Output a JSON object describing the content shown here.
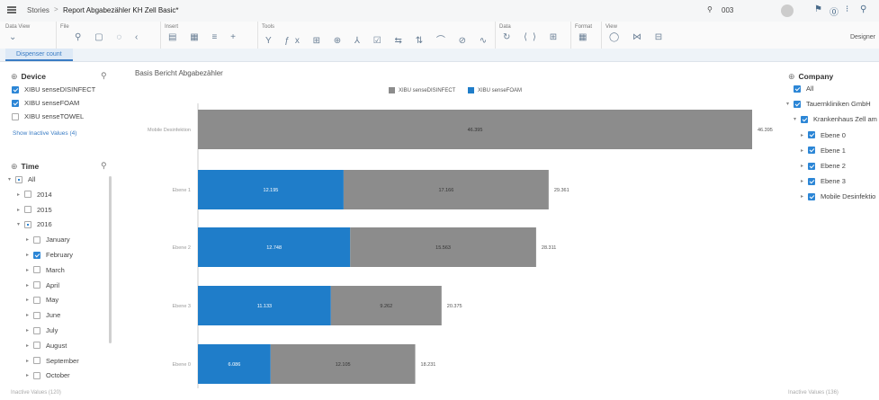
{
  "header": {
    "breadcrumb_root": "Stories",
    "separator": ">",
    "story_title": "Report Abgabezähler KH Zell Basic*",
    "search_value": "003"
  },
  "toolbar": {
    "groups": [
      {
        "label": "Data View",
        "icons": "⌄"
      },
      {
        "label": "File",
        "icons": "⚲ ▢ ◌ ‹"
      },
      {
        "label": "Insert",
        "icons": "▤ ▦ ≡ +"
      },
      {
        "label": "Tools",
        "icons": "Y ƒx ⊞ ⊕ ⅄ ☑ ⇆ ⇅ ⌒ ⊘ ∿"
      },
      {
        "label": "Data",
        "icons": "↻ ⟨⟩ ⊞"
      },
      {
        "label": "Format",
        "icons": "▦"
      },
      {
        "label": "View",
        "icons": "◯ ⋈ ⊟"
      }
    ],
    "designer_label": "Designer"
  },
  "tabs": [
    "Dispenser count"
  ],
  "device_filter": {
    "title": "Device",
    "items": [
      {
        "label": "XIBU senseDISINFECT",
        "checked": true
      },
      {
        "label": "XIBU senseFOAM",
        "checked": true
      },
      {
        "label": "XIBU senseTOWEL",
        "checked": false
      }
    ],
    "show_inactive": "Show Inactive Values (4)"
  },
  "time_filter": {
    "title": "Time",
    "items": [
      {
        "label": "All",
        "state": "partial",
        "caret": "▾",
        "indent": 0
      },
      {
        "label": "2014",
        "state": "off",
        "caret": "▸",
        "indent": 1
      },
      {
        "label": "2015",
        "state": "off",
        "caret": "▸",
        "indent": 1
      },
      {
        "label": "2016",
        "state": "partial",
        "caret": "▾",
        "indent": 1
      },
      {
        "label": "January",
        "state": "off",
        "caret": "▸",
        "indent": 2
      },
      {
        "label": "February",
        "state": "on",
        "caret": "▸",
        "indent": 2
      },
      {
        "label": "March",
        "state": "off",
        "caret": "▸",
        "indent": 2
      },
      {
        "label": "April",
        "state": "off",
        "caret": "▸",
        "indent": 2
      },
      {
        "label": "May",
        "state": "off",
        "caret": "▸",
        "indent": 2
      },
      {
        "label": "June",
        "state": "off",
        "caret": "▸",
        "indent": 2
      },
      {
        "label": "July",
        "state": "off",
        "caret": "▸",
        "indent": 2
      },
      {
        "label": "August",
        "state": "off",
        "caret": "▸",
        "indent": 2
      },
      {
        "label": "September",
        "state": "off",
        "caret": "▸",
        "indent": 2
      },
      {
        "label": "October",
        "state": "off",
        "caret": "▸",
        "indent": 2
      }
    ],
    "inactive": "Inactive Values (120)"
  },
  "company_filter": {
    "title": "Company",
    "items": [
      {
        "label": "All",
        "caret": "",
        "indent": 0
      },
      {
        "label": "Tauernkliniken GmbH",
        "caret": "▾",
        "indent": 0
      },
      {
        "label": "Krankenhaus Zell am",
        "caret": "▾",
        "indent": 1
      },
      {
        "label": "Ebene 0",
        "caret": "▸",
        "indent": 2
      },
      {
        "label": "Ebene 1",
        "caret": "▸",
        "indent": 2
      },
      {
        "label": "Ebene 2",
        "caret": "▸",
        "indent": 2
      },
      {
        "label": "Ebene 3",
        "caret": "▸",
        "indent": 2
      },
      {
        "label": "Mobile Desinfektio",
        "caret": "▸",
        "indent": 2
      }
    ],
    "inactive": "Inactive Values (136)"
  },
  "colors": {
    "disinfect": "#8c8c8c",
    "foam": "#1f7dc9",
    "accent": "#2c86d6"
  },
  "chart_data": {
    "type": "bar",
    "orientation": "horizontal",
    "stacked": true,
    "title": "Basis Bericht Abgabezähler",
    "categories": [
      "Mobile Desinfektion",
      "Ebene 1",
      "Ebene 2",
      "Ebene 3",
      "Ebene 0"
    ],
    "series": [
      {
        "name": "XIBU senseFOAM",
        "values": [
          0,
          12195,
          12748,
          11133,
          6086
        ]
      },
      {
        "name": "XIBU senseDISINFECT",
        "values": [
          46395,
          17166,
          15563,
          9262,
          12105
        ]
      }
    ],
    "totals": [
      "46.395",
      "29.361",
      "28.311",
      "20.375",
      "18.231"
    ],
    "data_labels": {
      "XIBU senseFOAM": [
        "",
        "12.195",
        "12.748",
        "11.133",
        "6.086"
      ],
      "XIBU senseDISINFECT": [
        "46.395",
        "17.166",
        "15.563",
        "9.262",
        "12.105"
      ]
    },
    "legend_order": [
      "XIBU senseDISINFECT",
      "XIBU senseFOAM"
    ],
    "legend_position": "top",
    "grid": false
  }
}
